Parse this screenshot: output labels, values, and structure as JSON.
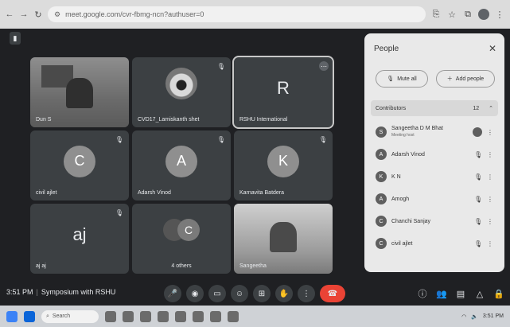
{
  "browser": {
    "url": "meet.google.com/cvr-fbmg-ncn?authuser=0",
    "icons": [
      "back-arrow-icon",
      "forward-arrow-icon",
      "reload-icon",
      "site-info-icon",
      "share-icon",
      "star-icon",
      "extensions-icon",
      "profile-icon",
      "menu-icon"
    ]
  },
  "tiles": [
    {
      "name": "Dun S",
      "type": "video"
    },
    {
      "name": "CVD17_Lamiskanth shet",
      "type": "image",
      "mic_off": true
    },
    {
      "name": "RSHU International",
      "type": "letter",
      "letter": "R",
      "active": true
    },
    {
      "name": "civil ajlet",
      "type": "circle",
      "letter": "C",
      "color": "#8f8f8f",
      "mic_off": true
    },
    {
      "name": "Adarsh Vinod",
      "type": "circle",
      "letter": "A",
      "color": "#8f8f8f",
      "mic_off": true
    },
    {
      "name": "Karnavita Batdera",
      "type": "circle",
      "letter": "K",
      "color": "#8f8f8f",
      "mic_off": true
    },
    {
      "name": "aj aj",
      "type": "letter",
      "letter": "aj",
      "mic_off": true
    },
    {
      "name": "4 others",
      "type": "others",
      "letter": "C"
    },
    {
      "name": "Sangeetha",
      "type": "video2"
    }
  ],
  "people": {
    "title": "People",
    "mute_all": "Mute all",
    "add_people": "Add people",
    "section": "Contributors",
    "count": "12",
    "list": [
      {
        "initial": "S",
        "name": "Sangeetha D M Bhat",
        "sub": "Meeting host"
      },
      {
        "initial": "A",
        "name": "Adarsh Vinod",
        "sub": ""
      },
      {
        "initial": "K",
        "name": "K N",
        "sub": ""
      },
      {
        "initial": "A",
        "name": "Amogh",
        "sub": ""
      },
      {
        "initial": "C",
        "name": "Chanchi Sanjay",
        "sub": ""
      },
      {
        "initial": "C",
        "name": "civil ajlet",
        "sub": ""
      }
    ]
  },
  "meeting": {
    "time": "3:51 PM",
    "name": "Symposium with RSHU"
  },
  "taskbar": {
    "search": "Search",
    "clock": "3:51 PM"
  }
}
